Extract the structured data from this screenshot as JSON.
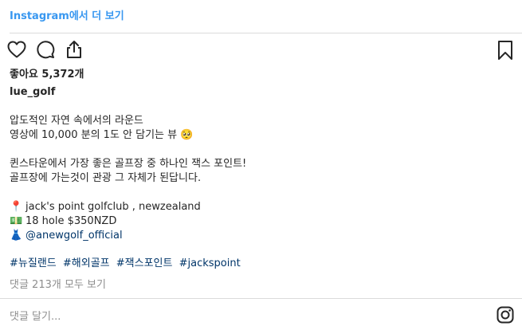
{
  "header": {
    "view_on_instagram": "Instagram에서 더 보기"
  },
  "post": {
    "likes": "좋아요 5,372개",
    "username": "lue_golf",
    "caption": {
      "line1": "압도적인 자연 속에서의 라운드",
      "line2": "영상에 10,000 분의 1도 안 담기는 뷰 🥺",
      "line3": "퀸스타운에서 가장 좋은 골프장 중 하나인 잭스 포인트!",
      "line4": "골프장에 가는것이 관광 그 자체가 된답니다.",
      "location_emoji": "📍",
      "location": "jack's point golfclub , newzealand",
      "price_emoji": "💵",
      "price": "18 hole $350NZD",
      "dress_emoji": "👗",
      "mention": "@anewgolf_official"
    },
    "hashtags": [
      "#뉴질랜드",
      "#해외골프",
      "#잭스포인트",
      "#jackspoint"
    ],
    "comments_link": "댓글 213개 모두 보기"
  },
  "comment_box": {
    "placeholder": "댓글 달기..."
  },
  "icons": {
    "like": "heart-icon",
    "comment": "comment-icon",
    "share": "share-icon",
    "save": "bookmark-icon",
    "brand": "instagram-icon"
  },
  "colors": {
    "link": "#3897f0",
    "hashtag": "#003569",
    "muted": "#8e8e8e",
    "divider": "#dbdbdb"
  }
}
